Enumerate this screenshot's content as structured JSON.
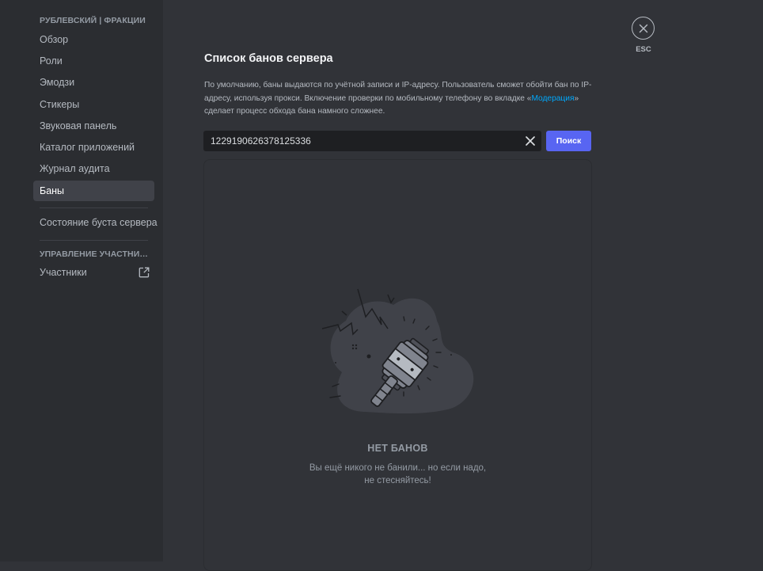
{
  "sidebar": {
    "section_server": "РУБЛЕВСКИЙ | ФРАКЦИИ",
    "items": [
      {
        "label": "Обзор"
      },
      {
        "label": "Роли"
      },
      {
        "label": "Эмодзи"
      },
      {
        "label": "Стикеры"
      },
      {
        "label": "Звуковая панель"
      },
      {
        "label": "Каталог приложений"
      },
      {
        "label": "Журнал аудита"
      },
      {
        "label": "Баны"
      }
    ],
    "boost_item": "Состояние буста сервера",
    "section_members": "УПРАВЛЕНИЕ УЧАСТНИКАМИ",
    "members_item": "Участники"
  },
  "close": {
    "label": "ESC",
    "icon": "close-icon"
  },
  "main": {
    "title": "Список банов сервера",
    "desc_part1": "По умолчанию, баны выдаются по учётной записи и IP-адресу. Пользователь сможет обойти бан по IP-адресу, используя прокси. Включение проверки по мобильному телефону во вкладке «",
    "desc_link": "Модерация",
    "desc_part2": "» сделает процесс обхода бана намного сложнее.",
    "search_value": "1229190626378125336",
    "search_button": "Поиск",
    "empty_title": "НЕТ БАНОВ",
    "empty_line1": "Вы ещё никого не банили... но если надо,",
    "empty_line2": "не стесняйтесь!"
  },
  "colors": {
    "background": "#313338",
    "sidebar": "#2b2d31",
    "accent": "#5865f2",
    "link": "#00a8fc"
  }
}
